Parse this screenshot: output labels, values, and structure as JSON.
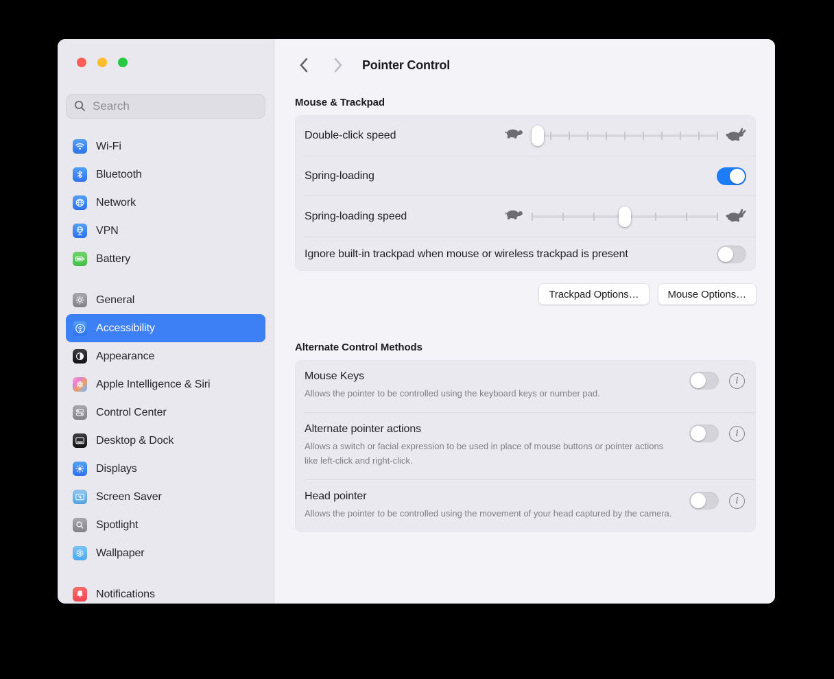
{
  "window": {
    "traffic_lights": {
      "close": "#FF5F57",
      "minimize": "#FEBC2E",
      "zoom": "#28C840"
    }
  },
  "colors": {
    "sidebar_selection_blue": "#3D80F5",
    "toggle_on_blue": "#1D7CF8",
    "window_bg": "#F4F3F8",
    "sidebar_bg": "#E9E8EE",
    "card_bg": "#EAE9EF"
  },
  "sidebar": {
    "search_placeholder": "Search",
    "items": [
      {
        "label": "Wi-Fi",
        "icon": "wifi-icon"
      },
      {
        "label": "Bluetooth",
        "icon": "bluetooth-icon"
      },
      {
        "label": "Network",
        "icon": "globe-icon"
      },
      {
        "label": "VPN",
        "icon": "vpn-globe-icon"
      },
      {
        "label": "Battery",
        "icon": "battery-icon"
      },
      {
        "label": "General",
        "icon": "gear-icon"
      },
      {
        "label": "Accessibility",
        "icon": "accessibility-icon",
        "selected": true
      },
      {
        "label": "Appearance",
        "icon": "appearance-icon"
      },
      {
        "label": "Apple Intelligence & Siri",
        "icon": "apple-intelligence-icon"
      },
      {
        "label": "Control Center",
        "icon": "control-center-icon"
      },
      {
        "label": "Desktop & Dock",
        "icon": "desktop-dock-icon"
      },
      {
        "label": "Displays",
        "icon": "sun-icon"
      },
      {
        "label": "Screen Saver",
        "icon": "screen-saver-icon"
      },
      {
        "label": "Spotlight",
        "icon": "magnifier-icon"
      },
      {
        "label": "Wallpaper",
        "icon": "flower-icon"
      },
      {
        "label": "Notifications",
        "icon": "bell-icon"
      }
    ]
  },
  "header": {
    "title": "Pointer Control"
  },
  "mouse_trackpad": {
    "section_title": "Mouse & Trackpad",
    "rows": [
      {
        "label": "Double-click speed",
        "control": "slider",
        "value_percent": 0,
        "tick_count": 11
      },
      {
        "label": "Spring-loading",
        "control": "toggle",
        "state": "on"
      },
      {
        "label": "Spring-loading speed",
        "control": "slider",
        "value_percent": 50,
        "tick_count": 7
      },
      {
        "label": "Ignore built-in trackpad when mouse or wireless trackpad is present",
        "control": "toggle",
        "state": "off"
      }
    ],
    "buttons": [
      "Trackpad Options…",
      "Mouse Options…"
    ]
  },
  "alternate": {
    "section_title": "Alternate Control Methods",
    "rows": [
      {
        "label": "Mouse Keys",
        "state": "off",
        "description": "Allows the pointer to be controlled using the keyboard keys or number pad."
      },
      {
        "label": "Alternate pointer actions",
        "state": "off",
        "description": "Allows a switch or facial expression to be used in place of mouse buttons or pointer actions like left-click and right-click."
      },
      {
        "label": "Head pointer",
        "state": "off",
        "description": "Allows the pointer to be controlled using the movement of your head captured by the camera."
      }
    ]
  }
}
